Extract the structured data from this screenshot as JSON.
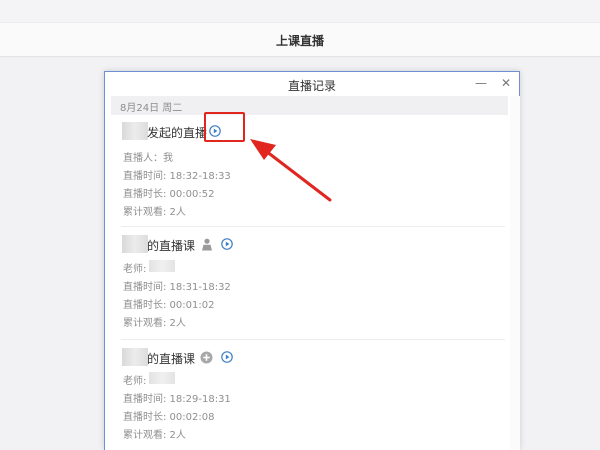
{
  "app": {
    "title": "上课直播"
  },
  "dialog": {
    "title": "直播记录",
    "minimize_glyph": "—",
    "close_glyph": "✕",
    "date_label": "8月24日 周二"
  },
  "records": [
    {
      "title": "发起的直播",
      "icons": [
        "play-icon"
      ],
      "lines": [
        "直播人：我",
        "直播时间: 18:32-18:33",
        "直播时长: 00:00:52",
        "累计观看: 2人"
      ]
    },
    {
      "title": "的直播课",
      "icons": [
        "person-icon",
        "play-icon"
      ],
      "lines": [
        "老师:",
        "直播时间: 18:31-18:32",
        "直播时长: 00:01:02",
        "累计观看: 2人"
      ]
    },
    {
      "title": "的直播课",
      "icons": [
        "plus-icon",
        "play-icon"
      ],
      "lines": [
        "老师:",
        "直播时间: 18:29-18:31",
        "直播时长: 00:02:08",
        "累计观看: 2人"
      ]
    }
  ],
  "annotation_color": "#e0261f",
  "accent_color": "#3d7fc4"
}
